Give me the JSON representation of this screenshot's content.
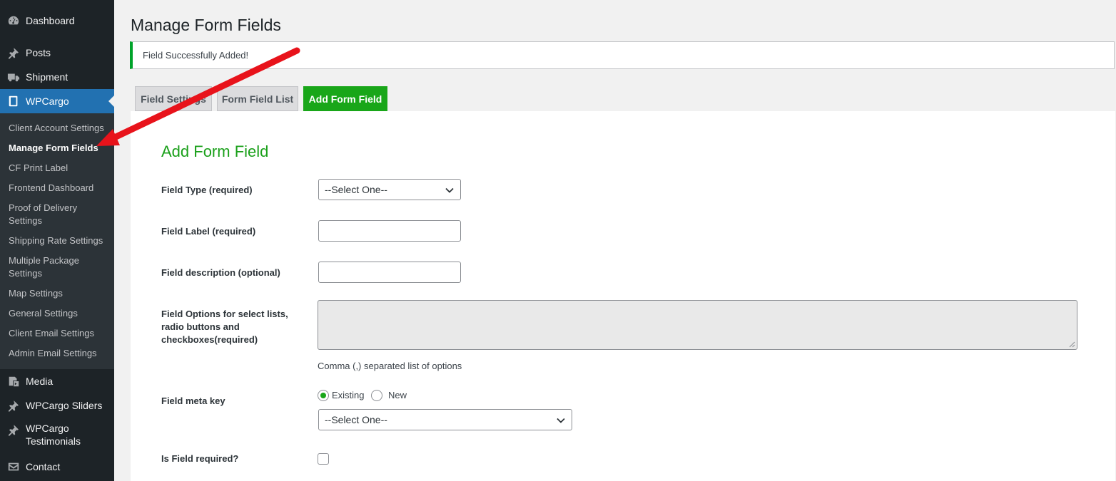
{
  "sidebar": {
    "menu": {
      "dashboard": "Dashboard",
      "posts": "Posts",
      "shipment": "Shipment",
      "wpcargo": "WPCargo",
      "media": "Media",
      "wpcargo_sliders": "WPCargo Sliders",
      "wpcargo_testimonials": "WPCargo Testimonials",
      "contact": "Contact"
    },
    "submenu": [
      "Client Account Settings",
      "Manage Form Fields",
      "CF Print Label",
      "Frontend Dashboard",
      "Proof of Delivery Settings",
      "Shipping Rate Settings",
      "Multiple Package Settings",
      "Map Settings",
      "General Settings",
      "Client Email Settings",
      "Admin Email Settings"
    ]
  },
  "page": {
    "title": "Manage Form Fields",
    "notice": "Field Successfully Added!"
  },
  "tabs": [
    "Field Settings",
    "Form Field List",
    "Add Form Field"
  ],
  "form": {
    "title": "Add Form Field",
    "field_type_label": "Field Type (required)",
    "field_type_value": "--Select One--",
    "field_label_label": "Field Label (required)",
    "field_description_label": "Field description (optional)",
    "field_options_label": "Field Options for select lists, radio buttons and checkboxes(required)",
    "field_options_hint": "Comma (,) separated list of options",
    "meta_key_label": "Field meta key",
    "meta_key_existing": "Existing",
    "meta_key_new": "New",
    "meta_key_value": "--Select One--",
    "required_label": "Is Field required?"
  },
  "colors": {
    "sidebar_bg": "#1d2327",
    "submenu_bg": "#2c3338",
    "current_menu": "#2271b1",
    "accent_green": "#19a619",
    "annotation_arrow": "#e8131b"
  }
}
